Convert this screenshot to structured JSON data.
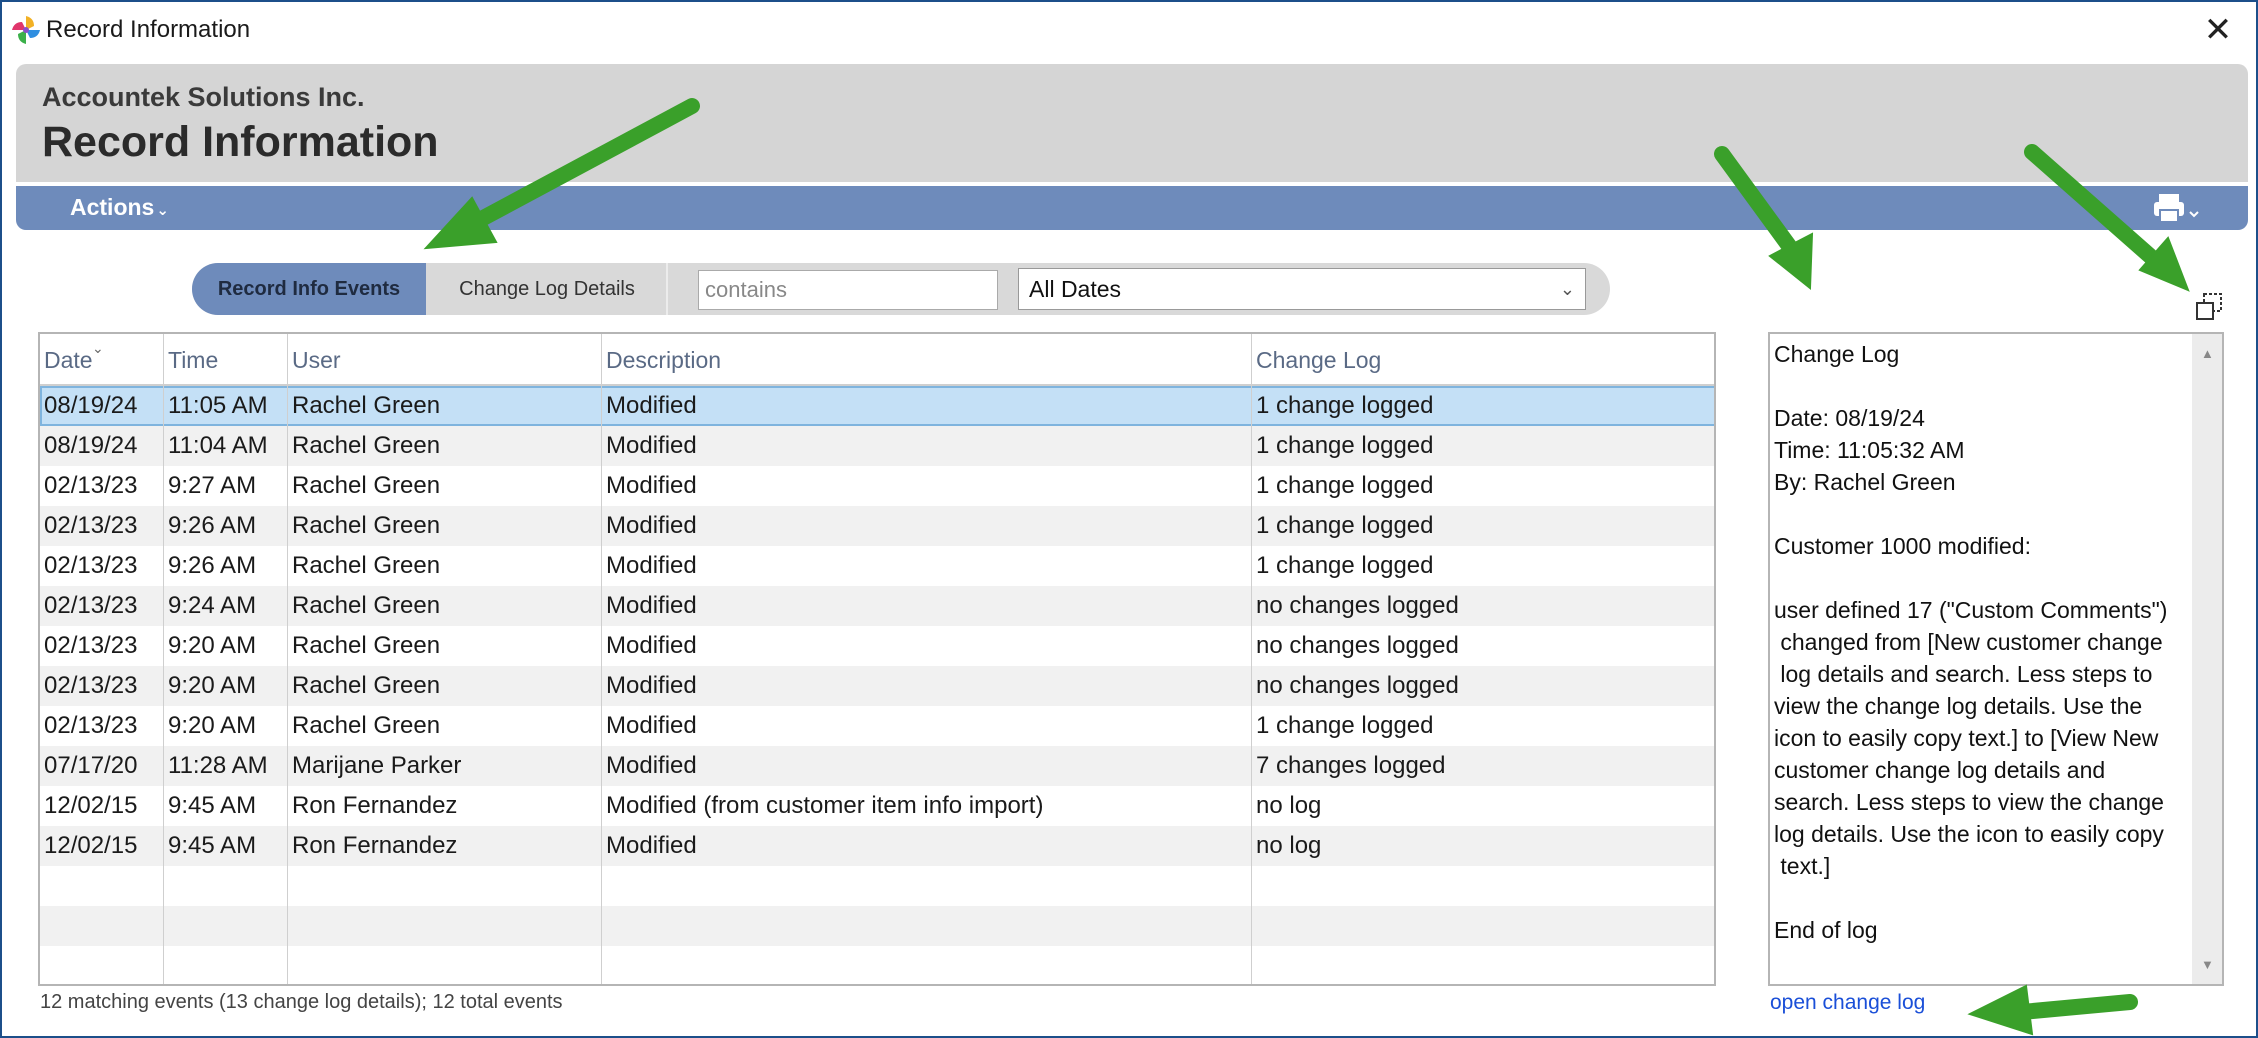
{
  "window": {
    "title": "Record Information",
    "close_glyph": "✕"
  },
  "header": {
    "company": "Accountek Solutions Inc.",
    "title": "Record Information"
  },
  "actionbar": {
    "actions_label": "Actions",
    "actions_chevron": "⌄"
  },
  "tabs": {
    "active": "Record Info Events",
    "inactive": "Change Log Details"
  },
  "search": {
    "placeholder": "contains"
  },
  "date_filter": {
    "selected": "All Dates",
    "chevron": "⌄"
  },
  "table": {
    "columns": [
      "Date",
      "Time",
      "User",
      "Description",
      "Change Log"
    ],
    "sort_glyph": "⌄",
    "rows": [
      [
        "08/19/24",
        "11:05 AM",
        "Rachel Green",
        "Modified",
        "1 change logged"
      ],
      [
        "08/19/24",
        "11:04 AM",
        "Rachel Green",
        "Modified",
        "1 change logged"
      ],
      [
        "02/13/23",
        "9:27 AM",
        "Rachel Green",
        "Modified",
        "1 change logged"
      ],
      [
        "02/13/23",
        "9:26 AM",
        "Rachel Green",
        "Modified",
        "1 change logged"
      ],
      [
        "02/13/23",
        "9:26 AM",
        "Rachel Green",
        "Modified",
        "1 change logged"
      ],
      [
        "02/13/23",
        "9:24 AM",
        "Rachel Green",
        "Modified",
        "no changes logged"
      ],
      [
        "02/13/23",
        "9:20 AM",
        "Rachel Green",
        "Modified",
        "no changes logged"
      ],
      [
        "02/13/23",
        "9:20 AM",
        "Rachel Green",
        "Modified",
        "no changes logged"
      ],
      [
        "02/13/23",
        "9:20 AM",
        "Rachel Green",
        "Modified",
        "1 change logged"
      ],
      [
        "07/17/20",
        "11:28 AM",
        "Marijane Parker",
        "Modified",
        "7 changes logged"
      ],
      [
        "12/02/15",
        "9:45 AM",
        "Ron Fernandez",
        "Modified (from customer item info import)",
        "no log"
      ],
      [
        "12/02/15",
        "9:45 AM",
        "Ron Fernandez",
        "Modified",
        "no log"
      ]
    ],
    "empty_rows": 3
  },
  "status": "12 matching events (13 change log details); 12 total events",
  "change_log": {
    "text": "Change Log\n\nDate: 08/19/24\nTime: 11:05:32 AM\nBy: Rachel Green\n\nCustomer 1000 modified:\n\nuser defined 17 (\"Custom Comments\")\n changed from [New customer change\n log details and search. Less steps to\nview the change log details. Use the\nicon to easily copy text.] to [View New\ncustomer change log details and\nsearch. Less steps to view the change\nlog details. Use the icon to easily copy\n text.]\n\nEnd of log",
    "open_link": "open change log"
  },
  "scroll_glyphs": {
    "up": "▲",
    "down": "▼"
  },
  "icons": {
    "app": "pinwheel-app-icon",
    "print": "printer-icon",
    "popout": "popout-copy-icon"
  },
  "colors": {
    "accent": "#6e8bbb",
    "selection": "#c4e0f6",
    "header_bg": "#d5d5d5",
    "link": "#1a4fd8",
    "annotation_arrow": "#3aa02a"
  }
}
